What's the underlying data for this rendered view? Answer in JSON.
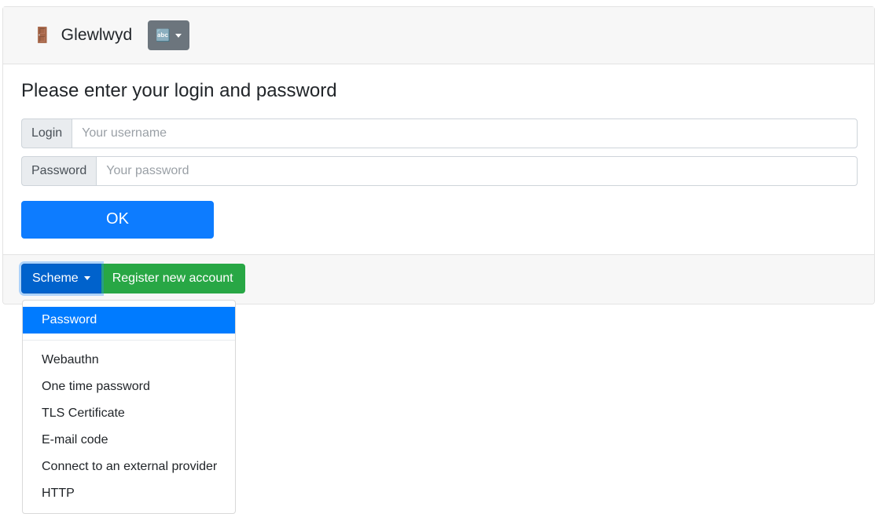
{
  "header": {
    "brand_icon": "door-icon",
    "brand_icon_glyph": "🚪",
    "brand_title": "Glewlwyd",
    "language_button": {
      "icon": "language-icon",
      "icon_glyph": "🔤",
      "label": ""
    }
  },
  "main": {
    "title": "Please enter your login and password",
    "fields": [
      {
        "label": "Login",
        "value": "",
        "placeholder": "Your username"
      },
      {
        "label": "Password",
        "value": "",
        "placeholder": "Your password"
      }
    ],
    "submit_label": "OK"
  },
  "footer": {
    "scheme_button_label": "Scheme",
    "register_button_label": "Register new account"
  },
  "scheme_menu": {
    "items": [
      {
        "label": "Password",
        "active": true
      },
      {
        "label": "Webauthn",
        "active": false
      },
      {
        "label": "One time password",
        "active": false
      },
      {
        "label": "TLS Certificate",
        "active": false
      },
      {
        "label": "E-mail code",
        "active": false
      },
      {
        "label": "Connect to an external provider",
        "active": false
      },
      {
        "label": "HTTP",
        "active": false
      }
    ]
  },
  "colors": {
    "primary": "#007bff",
    "primary_active": "#0062cc",
    "success": "#28a745",
    "secondary": "#6c757d",
    "header_bg": "#f7f7f7",
    "border": "#e3e3e3",
    "input_addon_bg": "#e9ecef"
  }
}
